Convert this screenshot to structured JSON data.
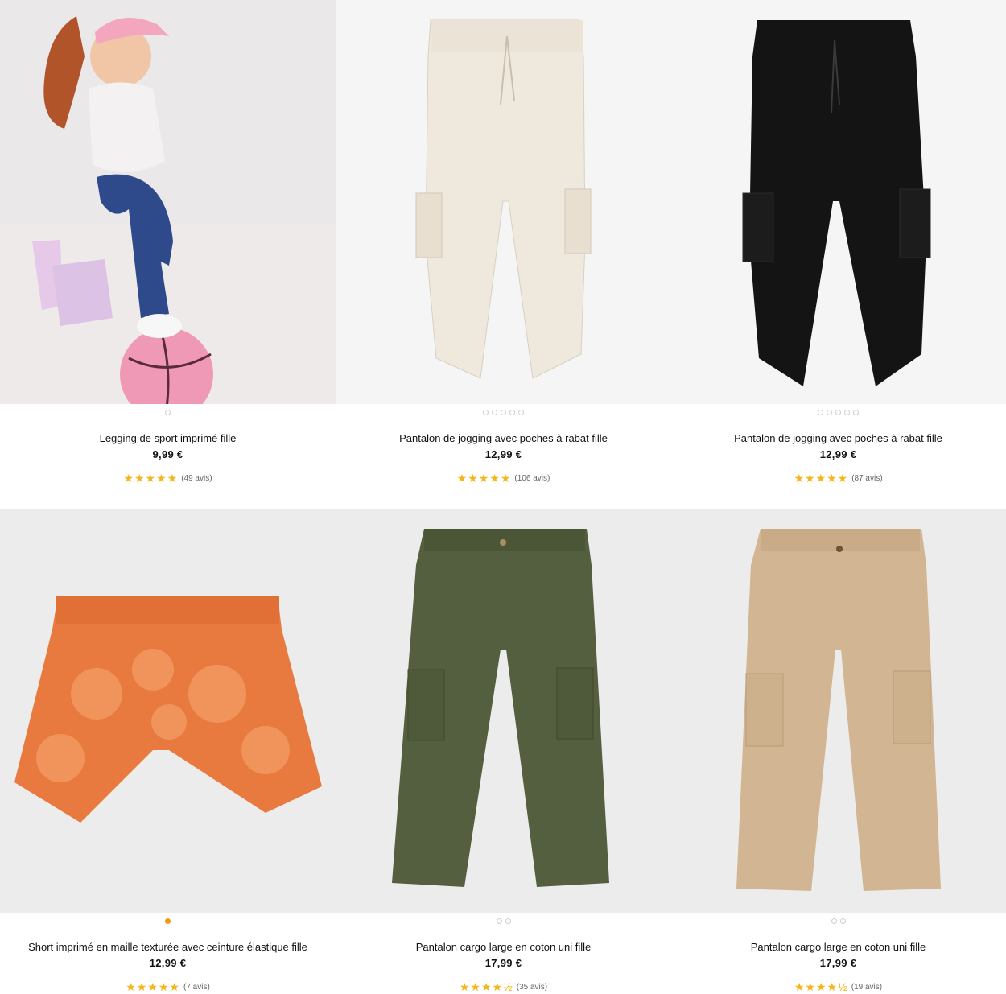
{
  "products": [
    {
      "name": "Legging de sport imprimé fille",
      "price": "9,99 €",
      "stars": "★★★★★",
      "reviews": "(49 avis)",
      "image": "girl-jumping-photo",
      "bg": "#e9e5e7"
    },
    {
      "name": "Pantalon de jogging avec poches à rabat fille",
      "price": "12,99 €",
      "stars": "★★★★★",
      "reviews": "(106 avis)",
      "image": "cream-cargo-jogger",
      "bg": "#f4f4f4",
      "color": "#efe9dd"
    },
    {
      "name": "Pantalon de jogging avec poches à rabat fille",
      "price": "12,99 €",
      "stars": "★★★★★",
      "reviews": "(87 avis)",
      "image": "black-cargo-jogger",
      "bg": "#f4f4f4",
      "color": "#141414"
    },
    {
      "name": "Short imprimé en maille texturée avec ceinture élastique fille",
      "price": "12,99 €",
      "stars": "★★★★★",
      "reviews": "(7 avis)",
      "image": "orange-printed-shorts",
      "bg": "#ececec",
      "color": "#e77a3f"
    },
    {
      "name": "Pantalon cargo large en coton uni fille",
      "price": "17,99 €",
      "stars": "★★★★½",
      "reviews": "(35 avis)",
      "image": "khaki-wide-cargo",
      "bg": "#ececec",
      "color": "#535f3e"
    },
    {
      "name": "Pantalon cargo large en coton uni fille",
      "price": "17,99 €",
      "stars": "★★★★½",
      "reviews": "(19 avis)",
      "image": "beige-wide-cargo",
      "bg": "#ececec",
      "color": "#d2b592"
    }
  ],
  "colors": {
    "star": "#f3b71c",
    "active_dot": "#f29a13"
  }
}
